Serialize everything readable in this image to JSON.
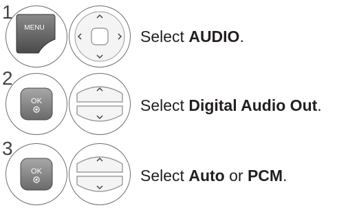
{
  "steps": [
    {
      "number": "1",
      "button_label": "MENU",
      "text_prefix": "Select ",
      "text_bold": "AUDIO",
      "text_suffix": "."
    },
    {
      "number": "2",
      "button_label": "OK",
      "text_prefix": "Select ",
      "text_bold": "Digital Audio Out",
      "text_suffix": "."
    },
    {
      "number": "3",
      "button_label": "OK",
      "text_prefix": "Select ",
      "text_bold": "Auto",
      "text_middle": " or ",
      "text_bold2": "PCM",
      "text_suffix": "."
    }
  ]
}
